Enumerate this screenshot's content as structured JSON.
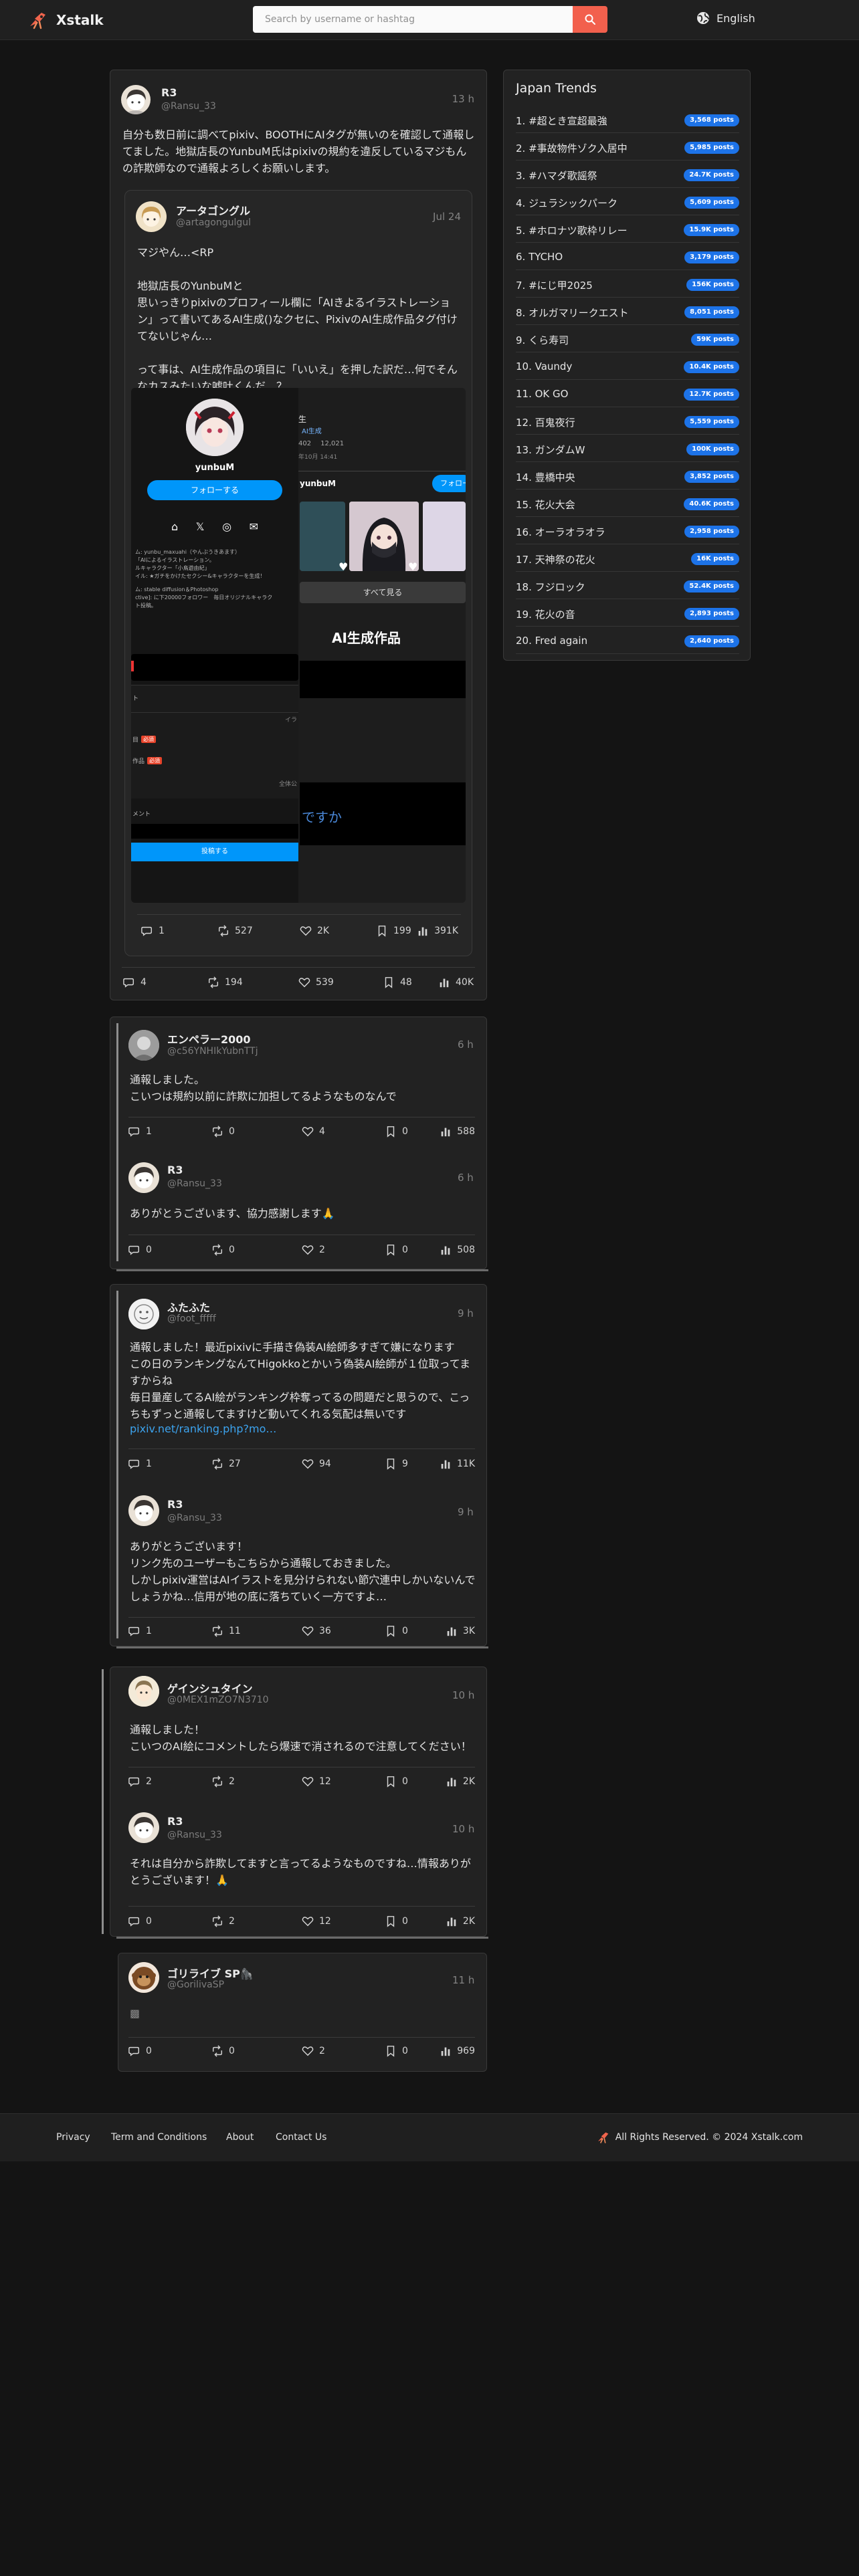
{
  "header": {
    "brand": "Xstalk",
    "search_placeholder": "Search by username or hashtag",
    "language": "English"
  },
  "stat_icons": [
    "reply-icon",
    "repost-icon",
    "like-icon",
    "bookmark-icon",
    "views-icon"
  ],
  "posts": [
    {
      "name": "R3",
      "handle": "@Ransu_33",
      "time": "13 h",
      "text": "自分も数日前に調べてpixiv、BOOTHにAIタグが無いのを確認して通報してました。地獄店長のYunbuM氏はpixivの規約を違反しているマジもんの詐欺師なので通報よろしくお願いします。",
      "stats": [
        "4",
        "194",
        "539",
        "48",
        "40K"
      ]
    },
    {
      "name": "アータゴングル",
      "handle": "@artagongulgul",
      "time": "Jul 24",
      "text": "マジやん…<RP\n\n地獄店長のYunbuMと\n思いっきりpixivのプロフィール欄に「AIきよるイラストレーション」って書いてあるAI生成()なクセに、PixivのAI生成作品タグ付けてないじゃん…\n\nって事は、AI生成作品の項目に「いいえ」を押した訳だ…何でそんなカスみたいな嘘吐くんだ…？",
      "stats": [
        "1",
        "527",
        "2K",
        "199",
        "391K"
      ]
    },
    {
      "name": "エンペラー2000",
      "handle": "@c56YNHIkYubnTTj",
      "time": "6 h",
      "text": "通報しました。\nこいつは規約以前に詐欺に加担してるようなものなんで",
      "stats": [
        "1",
        "0",
        "4",
        "0",
        "588"
      ]
    },
    {
      "name": "R3",
      "handle": "@Ransu_33",
      "time": "6 h",
      "text": "ありがとうございます、協力感謝します🙏",
      "stats": [
        "0",
        "0",
        "2",
        "0",
        "508"
      ]
    },
    {
      "name": "ふたふた",
      "handle": "@foot_fffff",
      "time": "9 h",
      "text": "通報しました！最近pixivに手描き偽装AI絵師多すぎて嫌になります\nこの日のランキングなんてHigokkoとかいう偽装AI絵師が１位取ってますからね\n毎日量産してるAI絵がランキング枠奪ってるの問題だと思うので、こっちもずっと通報してますけど動いてくれる気配は無いです",
      "link": "pixiv.net/ranking.php?mo…",
      "stats": [
        "1",
        "27",
        "94",
        "9",
        "11K"
      ]
    },
    {
      "name": "R3",
      "handle": "@Ransu_33",
      "time": "9 h",
      "text": "ありがとうございます！\nリンク先のユーザーもこちらから通報しておきました。\nしかしpixiv運営はAIイラストを見分けられない節穴連中しかいないんでしょうかね…信用が地の底に落ちていく一方ですよ…",
      "stats": [
        "1",
        "11",
        "36",
        "0",
        "3K"
      ]
    },
    {
      "name": "ゲインシュタイン",
      "handle": "@0MEX1mZO7N3710",
      "time": "10 h",
      "text": "通報しました！\nこいつのAI絵にコメントしたら爆速で消されるので注意してください！",
      "stats": [
        "2",
        "2",
        "12",
        "0",
        "2K"
      ]
    },
    {
      "name": "R3",
      "handle": "@Ransu_33",
      "time": "10 h",
      "text": "それは自分から詐欺してますと言ってるようなものですね…情報ありがとうございます！🙏",
      "stats": [
        "0",
        "2",
        "12",
        "0",
        "2K"
      ]
    },
    {
      "name": "ゴリライブ SP🦍",
      "handle": "@GorilivaSP",
      "time": "11 h",
      "text": "▩",
      "stats": [
        "0",
        "0",
        "2",
        "0",
        "969"
      ]
    }
  ],
  "embedded_screenshot": {
    "profile_name": "yunbuM",
    "follow_label": "フォローする",
    "follow_label_short": "フォロー",
    "profile_name_2": "yunbuM",
    "see_all_label": "すべて見る",
    "ai_works_label": "AI生成作品",
    "submit_label": "投稿する",
    "question_fragment": "ですか",
    "bio_lines": [
      "ム: yunbu_maxuahi（やんぶうきあます）",
      "「AIによるイラストレーション。",
      "ルキャラクター「小鳥遊由紀」",
      "イル: ★ガチをかけたセクシー&キャラクターを生成！",
      "",
      "ム: stable diffusion＆Photoshop",
      "ctive]: に下20000フォロワー　毎日オリジナルキャラク",
      "ト投稿。"
    ],
    "form_fragments": [
      "ト",
      "イラ",
      "作品",
      "全体公",
      "メント"
    ],
    "required_badge": "必須",
    "stats_fragment": "AI生成",
    "stats_counts": [
      "402",
      "12,021"
    ],
    "stats_date": "年10月 14:41"
  },
  "trends": {
    "title": "Japan Trends",
    "items": [
      {
        "name": "1. #超とき宣超最強",
        "count": "3,568 posts"
      },
      {
        "name": "2. #事故物件ゾク入居中",
        "count": "5,985 posts"
      },
      {
        "name": "3. #ハマダ歌謡祭",
        "count": "24.7K posts"
      },
      {
        "name": "4. ジュラシックパーク",
        "count": "5,609 posts"
      },
      {
        "name": "5. #ホロナツ歌枠リレー",
        "count": "15.9K posts"
      },
      {
        "name": "6. TYCHO",
        "count": "3,179 posts"
      },
      {
        "name": "7. #にじ甲2025",
        "count": "156K posts"
      },
      {
        "name": "8. オルガマリークエスト",
        "count": "8,051 posts"
      },
      {
        "name": "9. くら寿司",
        "count": "59K posts"
      },
      {
        "name": "10. Vaundy",
        "count": "10.4K posts"
      },
      {
        "name": "11. OK GO",
        "count": "12.7K posts"
      },
      {
        "name": "12. 百鬼夜行",
        "count": "5,559 posts"
      },
      {
        "name": "13. ガンダムW",
        "count": "100K posts"
      },
      {
        "name": "14. 豊橋中央",
        "count": "3,852 posts"
      },
      {
        "name": "15. 花火大会",
        "count": "40.6K posts"
      },
      {
        "name": "16. オーラオラオラ",
        "count": "2,958 posts"
      },
      {
        "name": "17. 天神祭の花火",
        "count": "16K posts"
      },
      {
        "name": "18. フジロック",
        "count": "52.4K posts"
      },
      {
        "name": "19. 花火の音",
        "count": "2,893 posts"
      },
      {
        "name": "20. Fred again",
        "count": "2,640 posts"
      }
    ]
  },
  "footer": {
    "links": [
      "Privacy",
      "Term and Conditions",
      "About",
      "Contact Us"
    ],
    "copyright": "All Rights Reserved. © 2024 Xstalk.com"
  }
}
